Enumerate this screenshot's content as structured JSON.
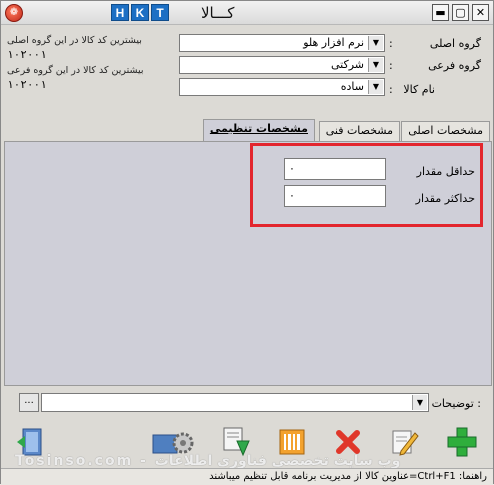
{
  "window": {
    "title": "کـــالا",
    "hkt": [
      "H",
      "K",
      "T"
    ]
  },
  "form": {
    "main_group_label": "گروه اصلی",
    "sub_group_label": "گروه فرعی",
    "item_name_label": "نام کالا",
    "colon": ":",
    "main_group_value": "نرم افزار هلو",
    "sub_group_value": "شرکتی",
    "item_name_value": "ساده",
    "max_code_main_label": "بیشترین کد کالا در این گروه اصلی",
    "max_code_main_value": "۱۰۲۰۰۱",
    "max_code_sub_label": "بیشترین کد کالا در این گروه فرعی",
    "max_code_sub_value": "۱۰۲۰۰۱"
  },
  "tabs": {
    "main_specs": "مشخصات اصلی",
    "tech_specs": "مشخصات فنی",
    "settings_specs": "مشخصات تنظیمی"
  },
  "panel": {
    "min_qty_label": "حداقل مقدار",
    "min_qty_value": "۰",
    "max_qty_label": "حداکثر مقدار",
    "max_qty_value": "۰"
  },
  "bottom": {
    "description_label": "توضیحات :",
    "dots": "..."
  },
  "status": {
    "hint": "راهنما: Ctrl+F1=عناوین کالا از مدیریت برنامه قابل تنظیم میباشند"
  },
  "watermark": "Tosinso.com - وب سایت تخصصی فناوری اطلاعات"
}
